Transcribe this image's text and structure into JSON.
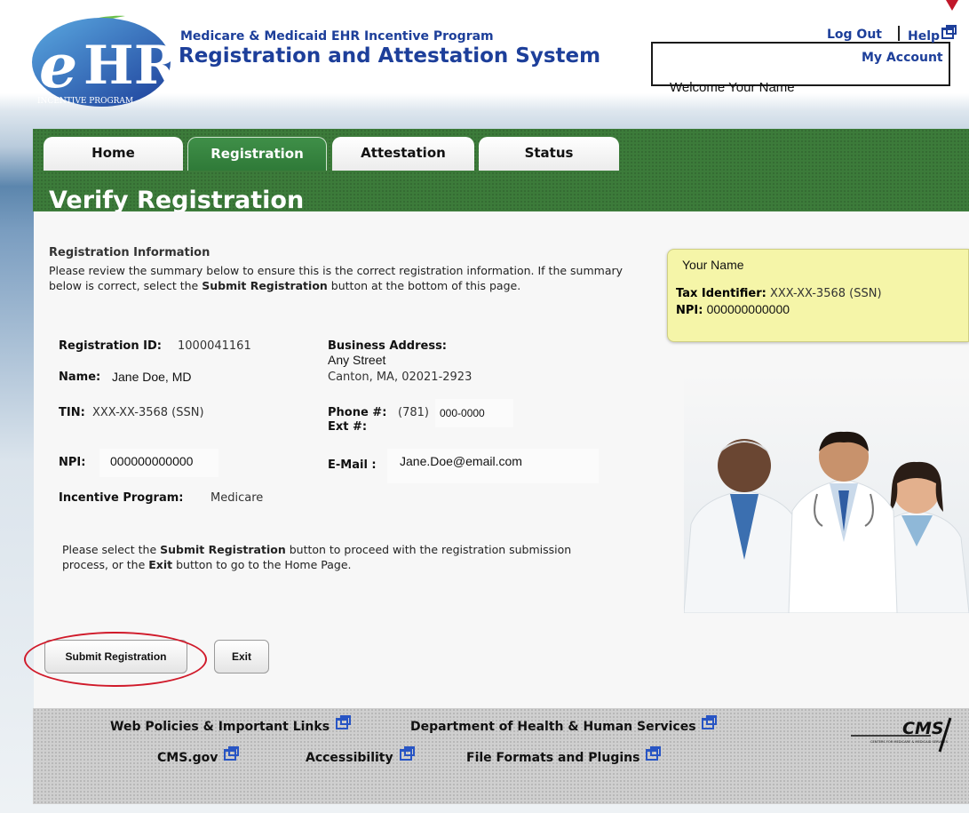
{
  "header": {
    "logo_text": "eHR",
    "logo_subtext": "INCENTIVE PROGRAM",
    "program_subtitle": "Medicare & Medicaid EHR Incentive Program",
    "program_title": "Registration and Attestation System",
    "welcome": "Welcome Your Name",
    "logout": "Log Out",
    "help": "Help",
    "my_account": "My Account"
  },
  "tabs": [
    {
      "label": "Home",
      "active": false
    },
    {
      "label": "Registration",
      "active": true
    },
    {
      "label": "Attestation",
      "active": false
    },
    {
      "label": "Status",
      "active": false
    }
  ],
  "page_title": "Verify Registration",
  "registration": {
    "section_title": "Registration Information",
    "intro_pre": "Please review the summary below to ensure this is the correct registration information. If the summary below is correct, select the ",
    "intro_bold": "Submit Registration",
    "intro_post": " button at the bottom of this page.",
    "id_label": "Registration ID:",
    "id_value": "1000041161",
    "name_label": "Name:",
    "name_value": "Jane Doe, MD",
    "tin_label": "TIN:",
    "tin_value": "XXX-XX-3568 (SSN)",
    "npi_label": "NPI:",
    "npi_value": "000000000000",
    "program_label": "Incentive Program:",
    "program_value": "Medicare",
    "address_label": "Business Address:",
    "address_line1": "Any Street",
    "address_line2": "Canton, MA, 02021-2923",
    "phone_label": "Phone #:",
    "phone_area": "(781)",
    "phone_number": "000-0000",
    "ext_label": "Ext #:",
    "email_label": "E-Mail :",
    "email_value": "Jane.Doe@email.com",
    "outro_1": "Please select the ",
    "outro_bold1": "Submit Registration",
    "outro_2": " button to proceed with the registration submission process, or the ",
    "outro_bold2": "Exit",
    "outro_3": " button to go to the Home Page."
  },
  "sidebar": {
    "name": "Your Name",
    "tax_label": "Tax Identifier:",
    "tax_value": "XXX-XX-3568 (SSN)",
    "npi_label": "NPI:",
    "npi_value": "000000000000"
  },
  "buttons": {
    "submit": "Submit Registration",
    "exit": "Exit"
  },
  "footer": {
    "web_policies": "Web Policies & Important Links",
    "hhs": "Department of Health & Human Services",
    "cms_gov": "CMS.gov",
    "accessibility": "Accessibility",
    "file_formats": "File Formats and Plugins",
    "cms_logo_text": "CMS",
    "cms_logo_subtext": "CENTERS FOR MEDICARE & MEDICAID SERVICES"
  },
  "colors": {
    "brand_blue": "#1d3f9a",
    "tab_green": "#3c7b3a",
    "highlight_red": "#d01a2a",
    "sidebar_yellow": "#f5f5a8"
  }
}
